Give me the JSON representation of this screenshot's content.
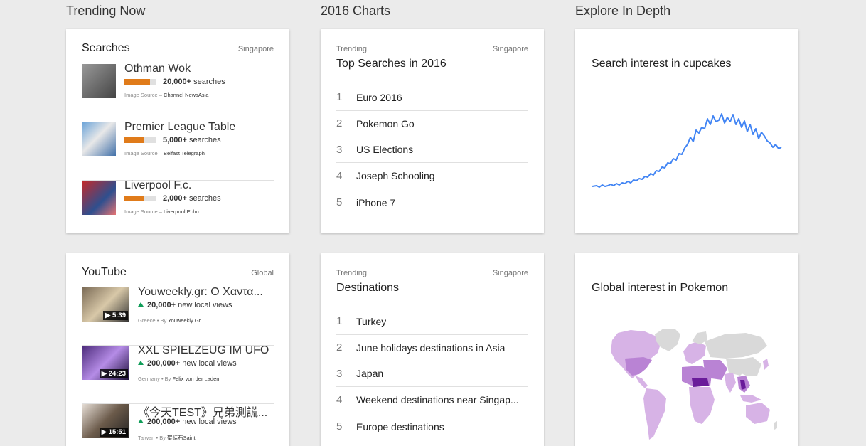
{
  "columns": {
    "trending": "Trending Now",
    "charts": "2016 Charts",
    "explore": "Explore In Depth"
  },
  "searches": {
    "title": "Searches",
    "region": "Singapore",
    "items": [
      {
        "title": "Othman Wok",
        "count": "20,000+",
        "count_suffix": "searches",
        "source_label": "Image Source –",
        "source": "Channel NewsAsia",
        "fill": 0.8
      },
      {
        "title": "Premier League Table",
        "count": "5,000+",
        "count_suffix": "searches",
        "source_label": "Image Source –",
        "source": "Belfast Telegraph",
        "fill": 0.6
      },
      {
        "title": "Liverpool F.c.",
        "count": "2,000+",
        "count_suffix": "searches",
        "source_label": "Image Source –",
        "source": "Liverpool Echo",
        "fill": 0.6
      }
    ]
  },
  "top_searches": {
    "subtitle": "Trending",
    "region": "Singapore",
    "title": "Top Searches in 2016",
    "items": [
      {
        "rank": "1",
        "label": "Euro 2016"
      },
      {
        "rank": "2",
        "label": "Pokemon Go"
      },
      {
        "rank": "3",
        "label": "US Elections"
      },
      {
        "rank": "4",
        "label": "Joseph Schooling"
      },
      {
        "rank": "5",
        "label": "iPhone 7"
      }
    ]
  },
  "explore_cupcakes": {
    "title": "Search interest in cupcakes",
    "line_color": "#4285f4"
  },
  "youtube": {
    "title": "YouTube",
    "region": "Global",
    "items": [
      {
        "title": "Youweekly.gr: Ο Χαντα...",
        "duration": "5:39",
        "views": "20,000+",
        "views_suffix": "new local views",
        "country": "Greece",
        "dot": "•",
        "by_label": "By",
        "by": "Youweekly Gr"
      },
      {
        "title": "XXL SPIELZEUG IM UFO",
        "duration": "24:23",
        "views": "200,000+",
        "views_suffix": "new local views",
        "country": "Germany",
        "dot": "•",
        "by_label": "By",
        "by": "Felix von der Laden"
      },
      {
        "title": "《今天TEST》兄弟測謊...",
        "duration": "15:51",
        "views": "200,000+",
        "views_suffix": "new local views",
        "country": "Taiwan",
        "dot": "•",
        "by_label": "By",
        "by": "聖結石Saint"
      }
    ]
  },
  "destinations": {
    "subtitle": "Trending",
    "region": "Singapore",
    "title": "Destinations",
    "items": [
      {
        "rank": "1",
        "label": "Turkey"
      },
      {
        "rank": "2",
        "label": "June holidays destinations in Asia"
      },
      {
        "rank": "3",
        "label": "Japan"
      },
      {
        "rank": "4",
        "label": "Weekend destinations near Singap..."
      },
      {
        "rank": "5",
        "label": "Europe destinations"
      }
    ]
  },
  "explore_pokemon": {
    "title": "Global interest in Pokemon"
  },
  "colors": {
    "bar": "#e07b1a",
    "up": "#0f9d58",
    "map_land": "#d9d9d9",
    "map_light": "#d7b3e6",
    "map_mid": "#b983d4",
    "map_dark": "#6a1b9a"
  }
}
